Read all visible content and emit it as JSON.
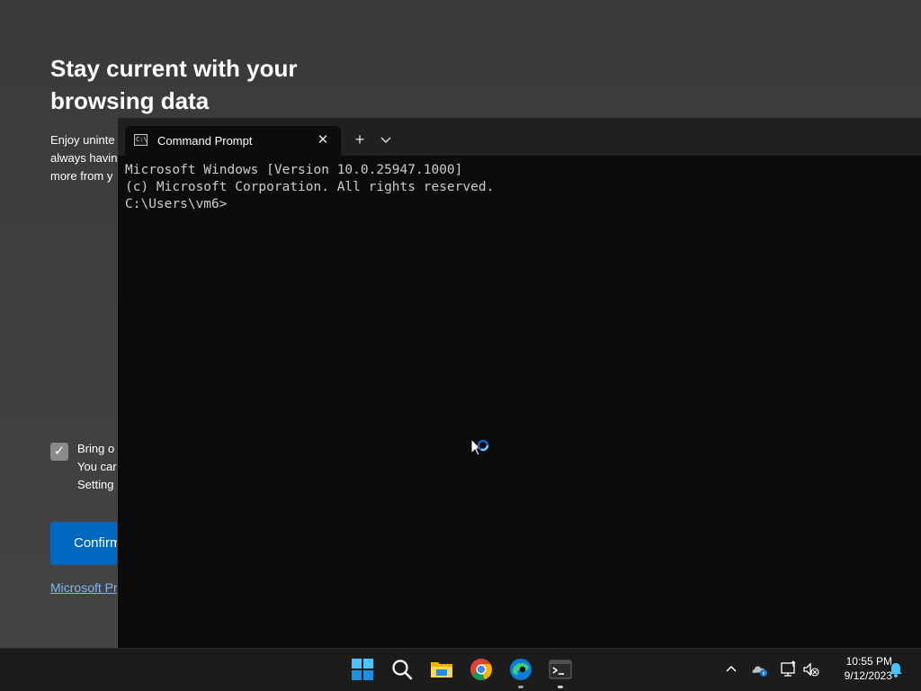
{
  "background_page": {
    "title": "Stay current with your browsing data",
    "description_lines": [
      "Enjoy uninte",
      "always havin",
      "more from y"
    ],
    "checkbox_checked": true,
    "checkbox_lines": [
      "Bring o",
      "You car",
      "Setting"
    ],
    "confirm_label": "Confirm",
    "privacy_link": "Microsoft Pri"
  },
  "terminal": {
    "tab_title": "Command Prompt",
    "tab_icon_text": "C:\\",
    "close_glyph": "✕",
    "new_tab_glyph": "+",
    "output_lines": [
      "Microsoft Windows [Version 10.0.25947.1000]",
      "(c) Microsoft Corporation. All rights reserved.",
      "",
      "C:\\Users\\vm6>"
    ]
  },
  "taskbar": {
    "apps": [
      {
        "name": "start",
        "icon": "windows-logo-icon"
      },
      {
        "name": "search",
        "icon": "search-icon"
      },
      {
        "name": "file-explorer",
        "icon": "folder-icon"
      },
      {
        "name": "chrome",
        "icon": "chrome-icon"
      },
      {
        "name": "edge",
        "icon": "edge-icon",
        "running": true
      },
      {
        "name": "terminal",
        "icon": "terminal-icon",
        "running": true
      }
    ],
    "tray": [
      "chevron-up-icon",
      "onedrive-icon",
      "network-icon",
      "volume-muted-icon",
      "bell-icon"
    ],
    "time": "10:55 PM",
    "date": "9/12/2023"
  },
  "colors": {
    "accent": "#0067c0",
    "terminal_bg": "#0c0c0c",
    "terminal_text": "#cccccc"
  }
}
